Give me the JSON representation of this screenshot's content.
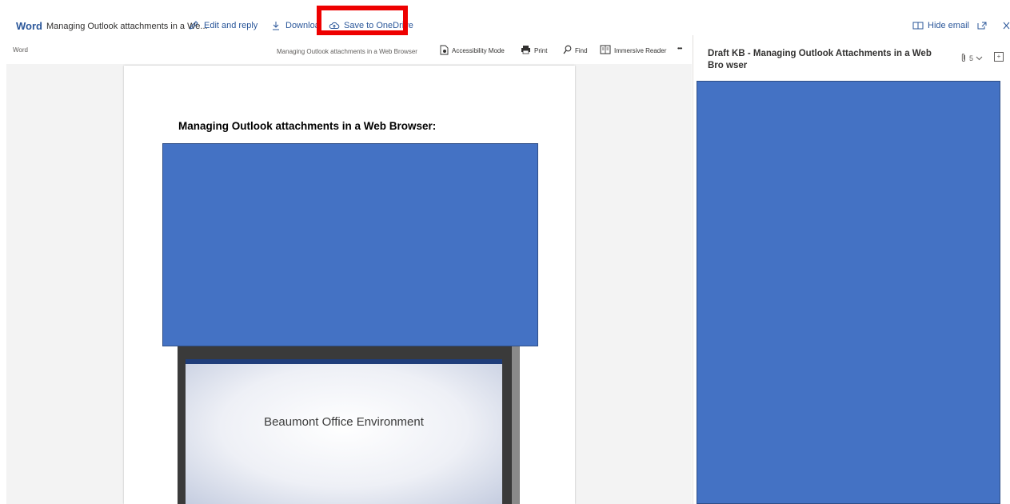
{
  "topbar": {
    "app_name": "Word",
    "doc_title": "Managing Outlook attachments in a We...",
    "edit_reply": "Edit and reply",
    "download": "Downloa",
    "save_onedrive": "Save to OneDrive",
    "hide_email": "Hide email",
    "accent": "#2b579a",
    "highlight_color": "#ee0000"
  },
  "viewer": {
    "app_label": "Word",
    "doc_name": "Managing Outlook attachments in a Web Browser",
    "accessibility": "Accessibility Mode",
    "print": "Print",
    "find": "Find",
    "immersive": "Immersive Reader",
    "more": "•••"
  },
  "document": {
    "heading": "Managing Outlook attachments in a Web Browser:",
    "slide_title": "Beaumont Office Environment",
    "redaction_color": "#4472c4"
  },
  "email": {
    "title": "Draft KB - Managing Outlook Attachments in a Web Bro wser",
    "attachment_count": "5"
  }
}
